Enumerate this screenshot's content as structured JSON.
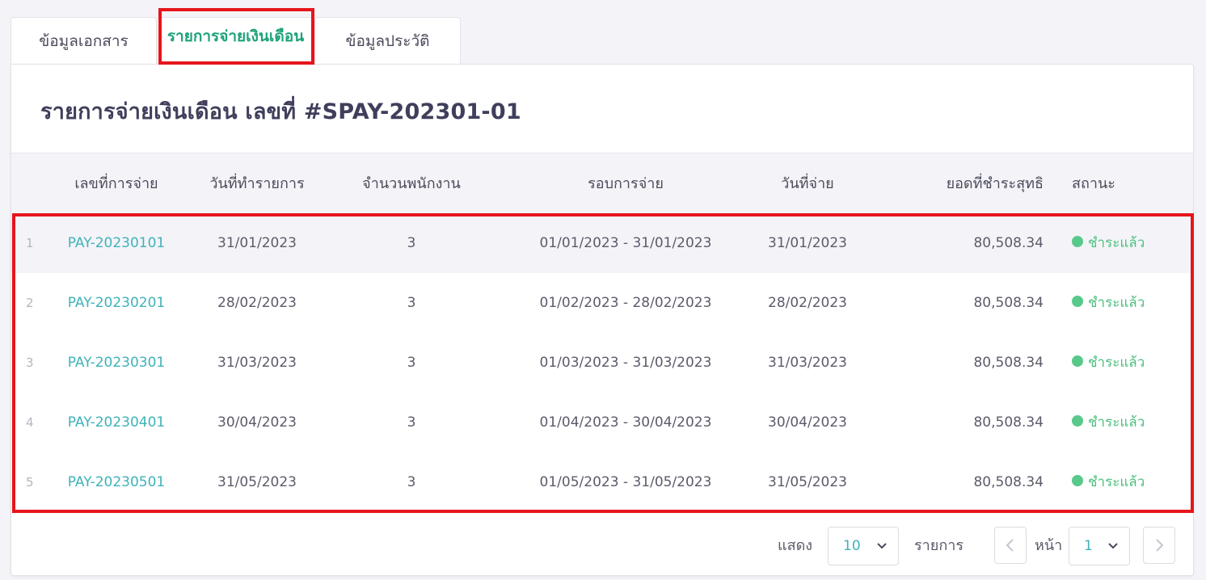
{
  "tabs": [
    {
      "label": "ข้อมูลเอกสาร"
    },
    {
      "label": "รายการจ่ายเงินเดือน"
    },
    {
      "label": "ข้อมูลประวัติ"
    }
  ],
  "card": {
    "title": "รายการจ่ายเงินเดือน เลขที่ #SPAY-202301-01"
  },
  "table": {
    "headers": [
      "เลขที่การจ่าย",
      "วันที่ทำรายการ",
      "จำนวนพนักงาน",
      "รอบการจ่าย",
      "วันที่จ่าย",
      "ยอดที่ชำระสุทธิ",
      "สถานะ"
    ],
    "rows": [
      {
        "idx": "1",
        "no": "PAY-20230101",
        "date": "31/01/2023",
        "employees": "3",
        "period": "01/01/2023 - 31/01/2023",
        "paid_date": "31/01/2023",
        "amount": "80,508.34",
        "status": "ชำระแล้ว"
      },
      {
        "idx": "2",
        "no": "PAY-20230201",
        "date": "28/02/2023",
        "employees": "3",
        "period": "01/02/2023 - 28/02/2023",
        "paid_date": "28/02/2023",
        "amount": "80,508.34",
        "status": "ชำระแล้ว"
      },
      {
        "idx": "3",
        "no": "PAY-20230301",
        "date": "31/03/2023",
        "employees": "3",
        "period": "01/03/2023 - 31/03/2023",
        "paid_date": "31/03/2023",
        "amount": "80,508.34",
        "status": "ชำระแล้ว"
      },
      {
        "idx": "4",
        "no": "PAY-20230401",
        "date": "30/04/2023",
        "employees": "3",
        "period": "01/04/2023 - 30/04/2023",
        "paid_date": "30/04/2023",
        "amount": "80,508.34",
        "status": "ชำระแล้ว"
      },
      {
        "idx": "5",
        "no": "PAY-20230501",
        "date": "31/05/2023",
        "employees": "3",
        "period": "01/05/2023 - 31/05/2023",
        "paid_date": "31/05/2023",
        "amount": "80,508.34",
        "status": "ชำระแล้ว"
      }
    ]
  },
  "pagination": {
    "show_label": "แสดง",
    "page_size": "10",
    "items_label": "รายการ",
    "page_label": "หน้า",
    "page": "1"
  },
  "colors": {
    "accent_teal": "#3fb2b8",
    "active_tab": "#1ea27a",
    "status_paid": "#59c98a",
    "annotation": "#e6151b"
  },
  "icons": [
    "chevron-down-icon",
    "chevron-left-icon",
    "chevron-right-icon",
    "status-dot-icon"
  ]
}
